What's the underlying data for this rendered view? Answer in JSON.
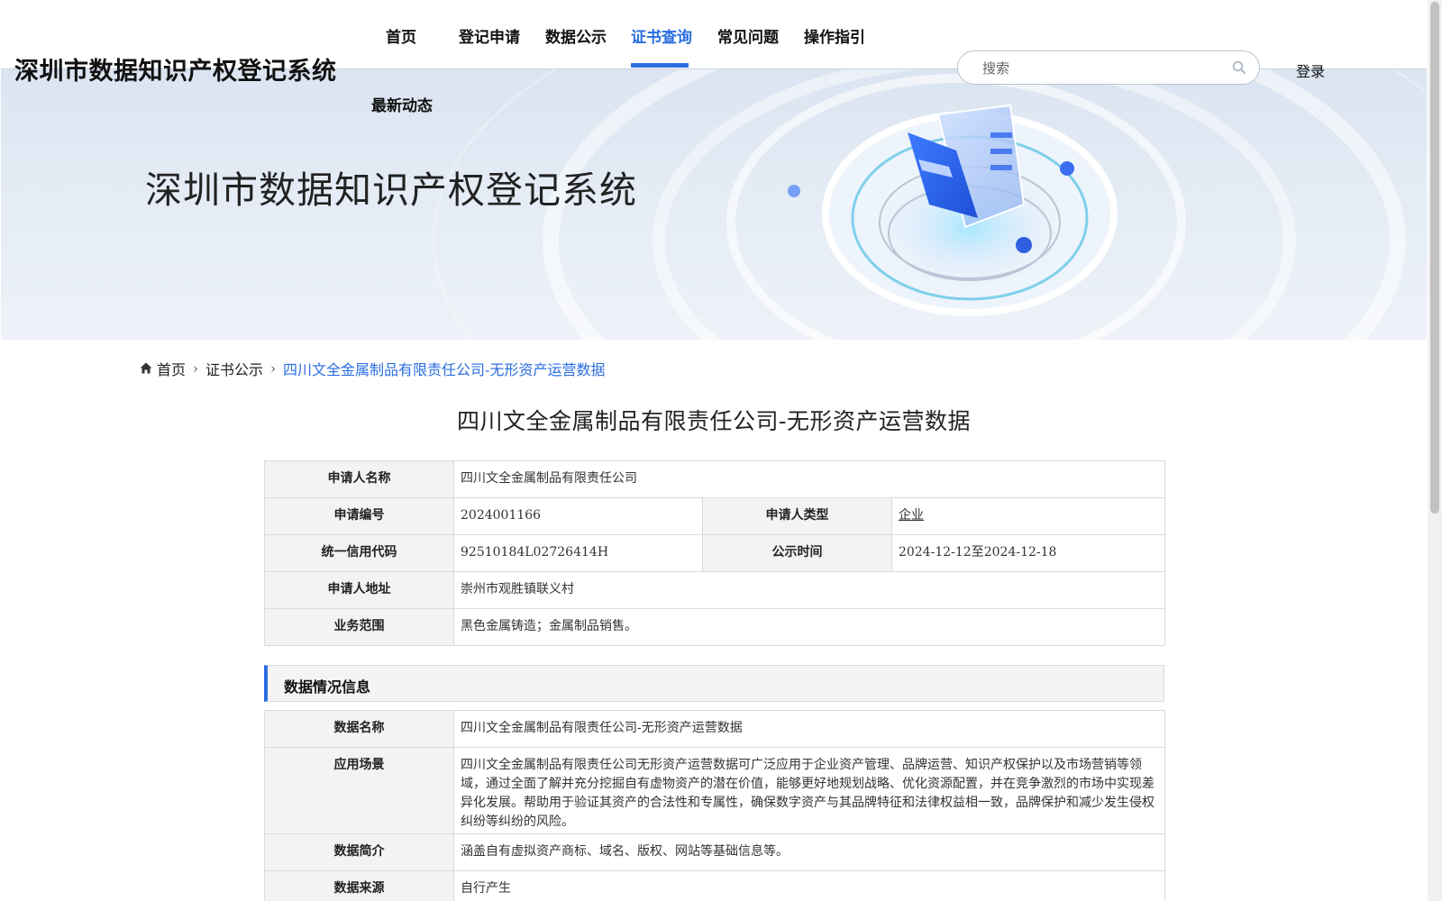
{
  "site": {
    "title": "深圳市数据知识产权登记系统",
    "banner_title": "深圳市数据知识产权登记系统"
  },
  "nav": {
    "items": [
      {
        "label": "首页"
      },
      {
        "label": "登记申请"
      },
      {
        "label": "数据公示"
      },
      {
        "label": "证书查询",
        "active": true
      },
      {
        "label": "常见问题"
      },
      {
        "label": "操作指引"
      },
      {
        "label": "最新动态"
      }
    ]
  },
  "search": {
    "placeholder": "搜索",
    "value": ""
  },
  "login_label": "登录",
  "breadcrumb": {
    "home": "首页",
    "section": "证书公示",
    "current": "四川文全金属制品有限责任公司-无形资产运营数据"
  },
  "detail": {
    "title": "四川文全金属制品有限责任公司-无形资产运营数据",
    "applicant": {
      "name_label": "申请人名称",
      "name": "四川文全金属制品有限责任公司",
      "number_label": "申请编号",
      "number": "2024001166",
      "type_label": "申请人类型",
      "type": "企业",
      "credit_label": "统一信用代码",
      "credit": "92510184L02726414H",
      "period_label": "公示时间",
      "period": "2024-12-12至2024-12-18",
      "address_label": "申请人地址",
      "address": "崇州市观胜镇联义村",
      "scope_label": "业务范围",
      "scope": "黑色金属铸造；金属制品销售。"
    },
    "data_section": {
      "heading": "数据情况信息",
      "name_label": "数据名称",
      "name": "四川文全金属制品有限责任公司-无形资产运营数据",
      "scenario_label": "应用场景",
      "scenario": "四川文全金属制品有限责任公司无形资产运营数据可广泛应用于企业资产管理、品牌运营、知识产权保护以及市场营销等领域，通过全面了解并充分挖掘自有虚物资产的潜在价值，能够更好地规划战略、优化资源配置，并在竞争激烈的市场中实现差异化发展。帮助用于验证其资产的合法性和专属性，确保数字资产与其品牌特征和法律权益相一致，品牌保护和减少发生侵权纠纷等纠纷的风险。",
      "intro_label": "数据简介",
      "intro": "涵盖自有虚拟资产商标、域名、版权、网站等基础信息等。",
      "source_label": "数据来源",
      "source": "自行产生"
    }
  },
  "colors": {
    "accent": "#2a6de0"
  }
}
